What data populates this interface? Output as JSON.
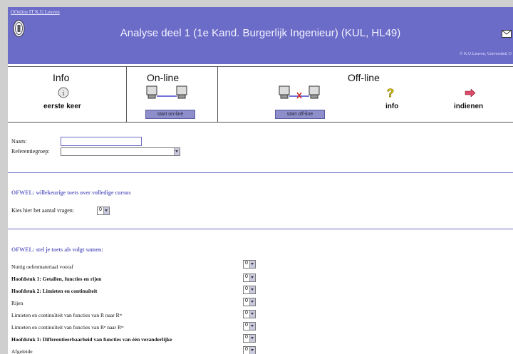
{
  "header": {
    "top_link": "OOnline IT K.U.Leuven",
    "title": "Analyse deel 1 (1e Kand. Burgerlijk Ingenieur) (KUL, HL49)",
    "copyright": "© K.U.Leuven, Universiteit O"
  },
  "toolbar": {
    "info_label": "Info",
    "info_sub": "eerste keer",
    "online_label": "On-line",
    "online_button": "start on-line",
    "offline_label": "Off-line",
    "offline_button": "start off-line",
    "offline_info": "info",
    "offline_submit": "indienen"
  },
  "form": {
    "name_label": "Naam:",
    "group_label": "Referentiegroep:",
    "section1_title": "OFWEL: willekeurige toets over volledige cursus",
    "count_label": "Kies hier het aantal vragen:",
    "count_value": "0",
    "section2_title": "OFWEL: stel je toets als volgt samen:",
    "rows": [
      {
        "label": "Nuttig oefenmateriaal vooraf",
        "bold": false,
        "value": "0"
      },
      {
        "label": "Hoofdstuk 1: Getallen, functies en rijen",
        "bold": true,
        "value": "0"
      },
      {
        "label": "Hoofdstuk 2: Limieten en continuïteit",
        "bold": true,
        "value": "0"
      },
      {
        "label": "Rijen",
        "bold": false,
        "value": "0"
      },
      {
        "label": "Limieten en continuïteit van functies van R naar Rᵐ",
        "bold": false,
        "value": "0"
      },
      {
        "label": "Limieten en continuïteit van functies van Rⁿ naar Rᵐ",
        "bold": false,
        "value": "0"
      },
      {
        "label": "Hoofdstuk 3: Differentieerbaarheid van functies van één veranderlijke",
        "bold": true,
        "value": "0"
      },
      {
        "label": "Afgeleide",
        "bold": false,
        "value": "0"
      }
    ]
  },
  "colors": {
    "header_bg": "#6b6bc8",
    "section_text": "#6b6bc8"
  }
}
